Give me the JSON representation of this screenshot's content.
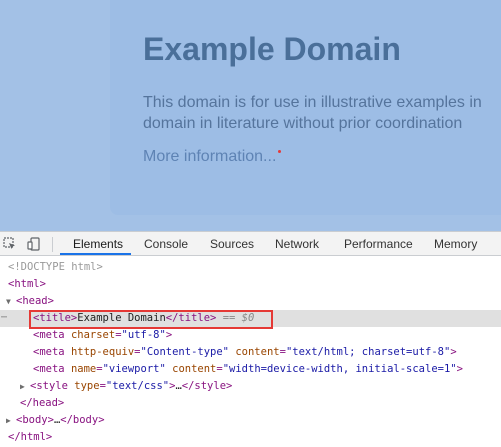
{
  "page": {
    "heading": "Example Domain",
    "paragraph_line1": "This domain is for use in illustrative examples in",
    "paragraph_line2": "domain in literature without prior coordination",
    "link": "More information..."
  },
  "devtools": {
    "tabs": [
      "Elements",
      "Console",
      "Sources",
      "Network",
      "Performance",
      "Memory"
    ],
    "active_tab": "Elements",
    "tree": {
      "doctype": "<!DOCTYPE html>",
      "html_open": "<html>",
      "head_open": "<head>",
      "title_open": "<title>",
      "title_text": "Example Domain",
      "title_close": "</title>",
      "title_marker": "== $0",
      "meta1_tag": "meta",
      "meta1_attr": "charset",
      "meta1_val": "\"utf-8\"",
      "meta2_tag": "meta",
      "meta2_attr1": "http-equiv",
      "meta2_val1": "\"Content-type\"",
      "meta2_attr2": "content",
      "meta2_val2": "\"text/html; charset=utf-8\"",
      "meta3_tag": "meta",
      "meta3_attr1": "name",
      "meta3_val1": "\"viewport\"",
      "meta3_attr2": "content",
      "meta3_val2": "\"width=device-width, initial-scale=1\"",
      "style_tag": "style",
      "style_attr": "type",
      "style_val": "\"text/css\"",
      "style_ellipsis": "…",
      "style_close": "</style>",
      "head_close": "</head>",
      "body_open": "<body>",
      "body_ellipsis": "…",
      "body_close": "</body>",
      "html_close": "</html>"
    }
  },
  "colors": {
    "highlight": "#e53935",
    "tab_underline": "#1a73e8",
    "tag": "#881280",
    "attr": "#994500",
    "val": "#1a1aa6"
  },
  "icons": [
    "inspect-element-icon",
    "device-toggle-icon"
  ]
}
